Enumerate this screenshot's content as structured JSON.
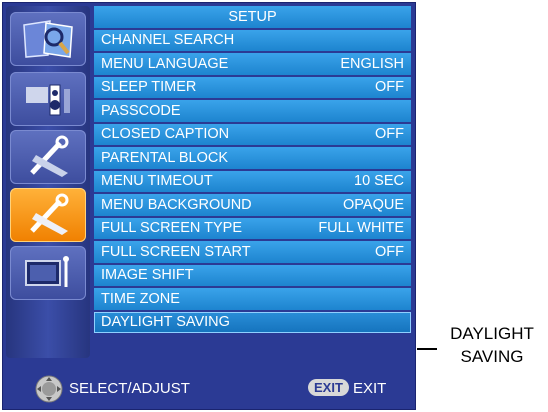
{
  "menu": {
    "title": "SETUP",
    "items": [
      {
        "label": "CHANNEL SEARCH",
        "value": ""
      },
      {
        "label": "MENU LANGUAGE",
        "value": "ENGLISH"
      },
      {
        "label": "SLEEP TIMER",
        "value": "OFF"
      },
      {
        "label": "PASSCODE",
        "value": ""
      },
      {
        "label": "CLOSED CAPTION",
        "value": "OFF"
      },
      {
        "label": "PARENTAL BLOCK",
        "value": ""
      },
      {
        "label": "MENU TIMEOUT",
        "value": "10 SEC"
      },
      {
        "label": "MENU BACKGROUND",
        "value": "OPAQUE"
      },
      {
        "label": "FULL SCREEN TYPE",
        "value": "FULL WHITE"
      },
      {
        "label": "FULL SCREEN START",
        "value": "OFF"
      },
      {
        "label": "IMAGE SHIFT",
        "value": ""
      },
      {
        "label": "TIME ZONE",
        "value": ""
      },
      {
        "label": "DAYLIGHT SAVING",
        "value": ""
      }
    ]
  },
  "sidebar": {
    "icons": [
      "picture-icon",
      "audio-icon",
      "tools-icon",
      "setup-tools-icon",
      "display-icon"
    ],
    "active": "setup-tools-icon"
  },
  "footer": {
    "select_label": "SELECT/ADJUST",
    "exit_key": "EXIT",
    "exit_label": "EXIT"
  },
  "callout": {
    "line1": "DAYLIGHT",
    "line2": "SAVING"
  },
  "colors": {
    "screen_bg": "#2b3a94",
    "row_blue": "#2a93dc",
    "active_icon": "#f59a1c"
  }
}
